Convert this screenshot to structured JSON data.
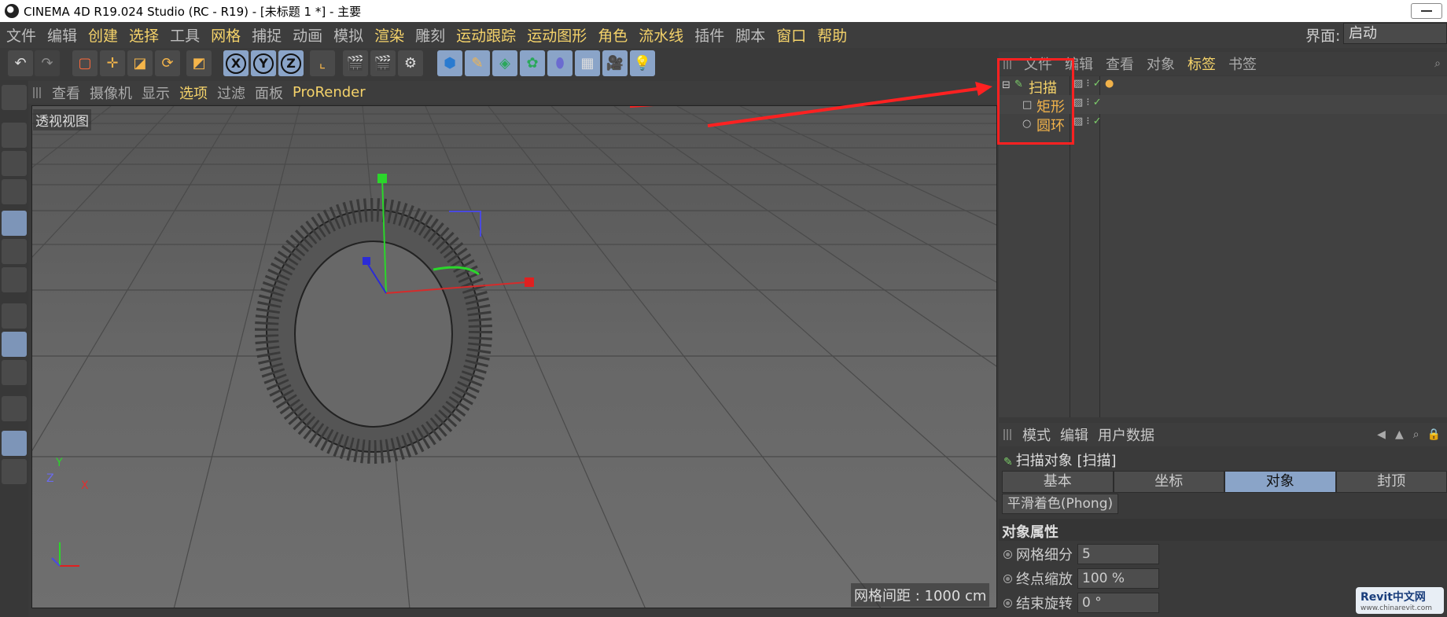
{
  "window": {
    "title": "CINEMA 4D R19.024 Studio (RC - R19) - [未标题 1 *] - 主要"
  },
  "menubar": {
    "items": [
      {
        "label": "文件",
        "hi": false
      },
      {
        "label": "编辑",
        "hi": false
      },
      {
        "label": "创建",
        "hi": true
      },
      {
        "label": "选择",
        "hi": true
      },
      {
        "label": "工具",
        "hi": false
      },
      {
        "label": "网格",
        "hi": true
      },
      {
        "label": "捕捉",
        "hi": false
      },
      {
        "label": "动画",
        "hi": false
      },
      {
        "label": "模拟",
        "hi": false
      },
      {
        "label": "渲染",
        "hi": true
      },
      {
        "label": "雕刻",
        "hi": false
      },
      {
        "label": "运动跟踪",
        "hi": true
      },
      {
        "label": "运动图形",
        "hi": true
      },
      {
        "label": "角色",
        "hi": true
      },
      {
        "label": "流水线",
        "hi": true
      },
      {
        "label": "插件",
        "hi": false
      },
      {
        "label": "脚本",
        "hi": false
      },
      {
        "label": "窗口",
        "hi": true
      },
      {
        "label": "帮助",
        "hi": true
      }
    ],
    "interface_label": "界面:",
    "interface_value": "启动"
  },
  "toolbar": {
    "x_label": "X",
    "y_label": "Y",
    "z_label": "Z"
  },
  "viewport": {
    "menu": [
      {
        "label": "查看",
        "cls": ""
      },
      {
        "label": "摄像机",
        "cls": ""
      },
      {
        "label": "显示",
        "cls": ""
      },
      {
        "label": "选项",
        "cls": "hi"
      },
      {
        "label": "过滤",
        "cls": ""
      },
      {
        "label": "面板",
        "cls": ""
      },
      {
        "label": "ProRender",
        "cls": "hi"
      }
    ],
    "view_name": "透视视图",
    "grid_spacing": "网格间距 : 1000 cm",
    "axis_x": "X",
    "axis_y": "Y",
    "axis_z": "Z"
  },
  "object_manager": {
    "menu": [
      {
        "label": "文件",
        "hi": false
      },
      {
        "label": "编辑",
        "hi": false
      },
      {
        "label": "查看",
        "hi": false
      },
      {
        "label": "对象",
        "hi": false
      },
      {
        "label": "标签",
        "hi": true
      },
      {
        "label": "书签",
        "hi": false
      }
    ],
    "objects": [
      {
        "name": "扫描",
        "icon": "sweep-icon"
      },
      {
        "name": "矩形",
        "icon": "rectangle-icon"
      },
      {
        "name": "圆环",
        "icon": "circle-icon"
      }
    ]
  },
  "attributes": {
    "menu": [
      "模式",
      "编辑",
      "用户数据"
    ],
    "title": "扫描对象 [扫描]",
    "tabs": [
      {
        "label": "基本",
        "active": false
      },
      {
        "label": "坐标",
        "active": false
      },
      {
        "label": "对象",
        "active": true
      },
      {
        "label": "封顶",
        "active": false
      }
    ],
    "phong_tab": "平滑着色(Phong)",
    "section": "对象属性",
    "props": [
      {
        "label": "网格细分",
        "value": "5"
      },
      {
        "label": "终点缩放",
        "value": "100 %"
      },
      {
        "label": "结束旋转",
        "value": "0 °"
      }
    ]
  },
  "watermark": {
    "name": "Revit中文网",
    "url": "www.chinarevit.com"
  },
  "colors": {
    "highlight": "#f5d36a",
    "object_name": "#f1b24a",
    "annotation": "#ff2121",
    "active_tab": "#8aa4c8"
  }
}
